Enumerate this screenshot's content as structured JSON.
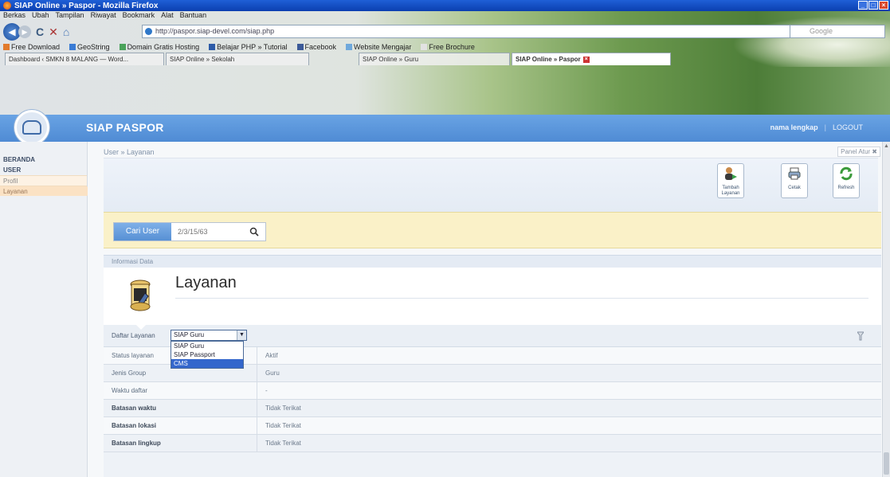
{
  "browser": {
    "window_title": "SIAP Online » Paspor - Mozilla Firefox",
    "menu": [
      "Berkas",
      "Ubah",
      "Tampilan",
      "Riwayat",
      "Bookmark",
      "Alat",
      "Bantuan"
    ],
    "url": "http://paspor.siap-devel.com/siap.php",
    "search_placeholder": "Google",
    "bookmarks": [
      "Free Download",
      "GeoString",
      "Domain Gratis Hosting",
      "Belajar PHP » Tutorial",
      "Facebook",
      "Website Mengajar",
      "Free Brochure"
    ],
    "tabs": [
      {
        "label": "Dashboard ‹ SMKN 8 MALANG — Word...",
        "active": false
      },
      {
        "label": "SIAP Online » Sekolah",
        "active": false
      },
      {
        "label": "SIAP Online » Guru",
        "active": false
      },
      {
        "label": "SIAP Online » Paspor",
        "active": true
      }
    ]
  },
  "app": {
    "brand": "SIAP PASPOR",
    "user_name": "nama lengkap",
    "logout": "LOGOUT",
    "sidebar": {
      "beranda": "BERANDA",
      "user": "USER",
      "items": [
        {
          "label": "Profil",
          "active": false
        },
        {
          "label": "Layanan",
          "active": true
        }
      ]
    },
    "breadcrumb": "User » Layanan",
    "panel_button": "Panel Atur",
    "toolbar": {
      "tambah": "Tambah Layanan",
      "cetak": "Cetak",
      "refresh": "Refresh"
    },
    "search": {
      "button": "Cari User",
      "placeholder": "2/3/15/63"
    },
    "info_label": "Informasi Data",
    "page_title": "Layanan",
    "filter": {
      "label": "Daftar Layanan",
      "selected": "SIAP Guru",
      "options": [
        "SIAP Guru",
        "SIAP Passport",
        "CMS"
      ],
      "highlighted": "CMS"
    },
    "rows": [
      {
        "key": "Status layanan",
        "value": "Aktif",
        "bold": false
      },
      {
        "key": "Jenis Group",
        "value": "Guru",
        "bold": false
      },
      {
        "key": "Waktu daftar",
        "value": "-",
        "bold": false
      },
      {
        "key": "Batasan waktu",
        "value": "Tidak Terikat",
        "bold": true
      },
      {
        "key": "Batasan lokasi",
        "value": "Tidak Terikat",
        "bold": true
      },
      {
        "key": "Batasan lingkup",
        "value": "Tidak Terikat",
        "bold": true
      }
    ]
  },
  "colors": {
    "header_blue": "#5b95da",
    "search_bg": "#faf1c8",
    "dropdown_highlight": "#3366cc"
  }
}
